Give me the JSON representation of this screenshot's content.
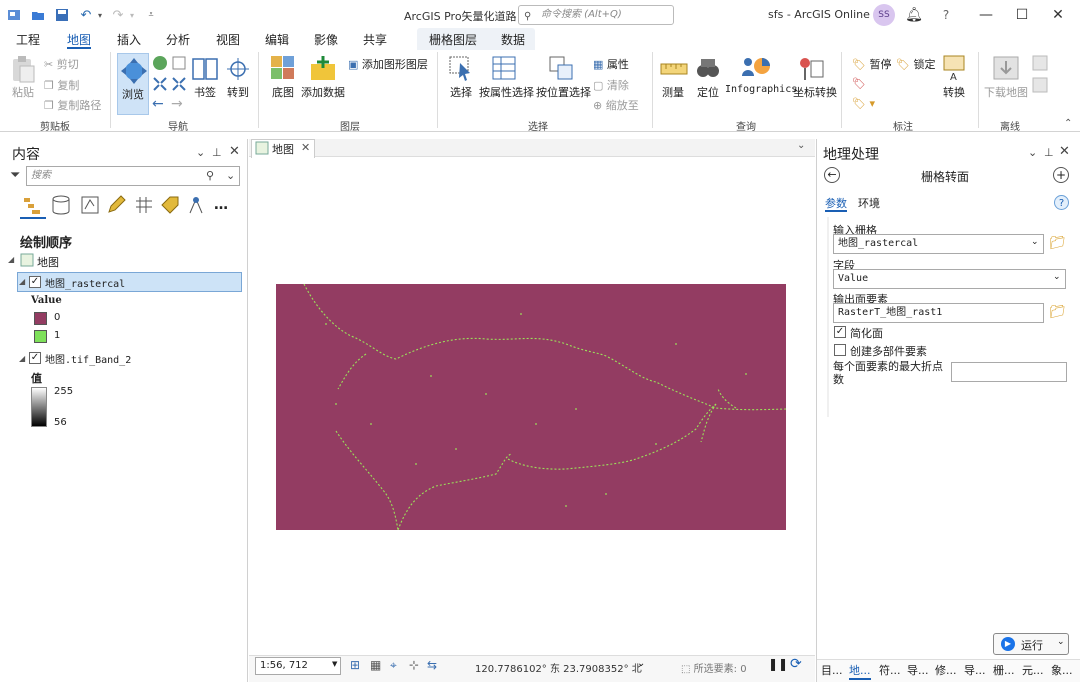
{
  "app": {
    "title": "ArcGIS Pro矢量化道路",
    "search_placeholder": "命令搜索 (Alt+Q)",
    "user": "sfs - ArcGIS Online",
    "avatar": "SS"
  },
  "ribbon_tabs": [
    "工程",
    "地图",
    "插入",
    "分析",
    "视图",
    "编辑",
    "影像",
    "共享"
  ],
  "active_tab": "地图",
  "contextual_tabs": [
    "栅格图层",
    "数据"
  ],
  "ribbon": {
    "clipboard": {
      "paste": "粘贴",
      "cut": "剪切",
      "copy": "复制",
      "copy_path": "复制路径",
      "label": "剪贴板"
    },
    "navigate": {
      "explore": "浏览",
      "bookmarks": "书签",
      "goto": "转到",
      "label": "导航"
    },
    "layer": {
      "basemap": "底图",
      "add_data": "添加数据",
      "add_graphics": "添加图形图层",
      "label": "图层"
    },
    "selection": {
      "select": "选择",
      "by_attr": "按属性选择",
      "by_loc": "按位置选择",
      "attributes": "属性",
      "clear": "清除",
      "zoom": "缩放至",
      "label": "选择"
    },
    "inquiry": {
      "measure": "测量",
      "locate": "定位",
      "infographics": "Infographics",
      "coord": "坐标转换",
      "label": "查询"
    },
    "labeling": {
      "pause": "暂停",
      "lock": "锁定",
      "convert": "转换",
      "label": "标注"
    },
    "offline": {
      "download": "下载地图",
      "label": "离线"
    }
  },
  "contents": {
    "title": "内容",
    "search_placeholder": "搜索",
    "draw_order": "绘制顺序",
    "map_node": "地图",
    "layer1": {
      "name": "地图_rastercal",
      "field": "Value",
      "classes": [
        {
          "label": "0",
          "color": "#933c62"
        },
        {
          "label": "1",
          "color": "#7ee05a"
        }
      ]
    },
    "layer2": {
      "name": "地图.tif_Band_2",
      "field": "值",
      "max": "255",
      "min": "56"
    }
  },
  "map": {
    "tab": "地图",
    "raster_color": "#933c62",
    "line_color": "#9be05a"
  },
  "status": {
    "scale": "1:56, 712",
    "coords": "120.7786102° 东  23.7908352° 北",
    "selected": "所选要素: 0"
  },
  "gp": {
    "title": "地理处理",
    "tool": "栅格转面",
    "tabs": [
      "参数",
      "环境"
    ],
    "input_raster_label": "输入栅格",
    "input_raster": "地图_rastercal",
    "field_label": "字段",
    "field": "Value",
    "output_label": "输出面要素",
    "output": "RasterT_地图_rast1",
    "simplify": "简化面",
    "multipart": "创建多部件要素",
    "max_vertices_label": "每个面要素的最大折点数",
    "run": "运行",
    "bottom_tabs": [
      "目...",
      "地...",
      "符...",
      "导...",
      "修...",
      "导...",
      "栅...",
      "元...",
      "象..."
    ]
  }
}
